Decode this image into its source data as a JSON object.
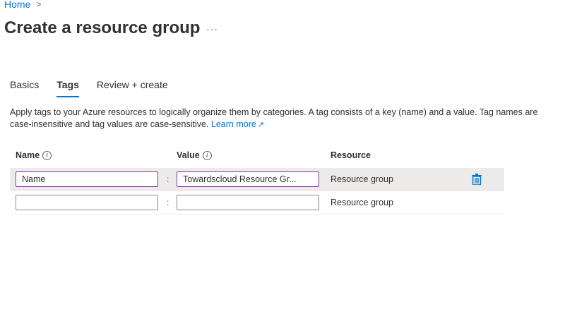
{
  "breadcrumb": {
    "home": "Home",
    "separator": ">"
  },
  "page": {
    "title": "Create a resource group",
    "more": "···"
  },
  "tabs": [
    {
      "label": "Basics",
      "active": false
    },
    {
      "label": "Tags",
      "active": true
    },
    {
      "label": "Review + create",
      "active": false
    }
  ],
  "description": {
    "text": "Apply tags to your Azure resources to logically organize them by categories. A tag consists of a key (name) and a value. Tag names are case-insensitive and tag values are case-sensitive.",
    "link": "Learn more"
  },
  "table": {
    "headers": {
      "name": "Name",
      "value": "Value",
      "resource": "Resource"
    },
    "separator": ":",
    "rows": [
      {
        "name": "Name",
        "value": "Towardscloud Resource Gr...",
        "resource": "Resource group"
      },
      {
        "name": "",
        "value": "",
        "resource": "Resource group"
      }
    ]
  },
  "colors": {
    "accent": "#0078d4",
    "focus": "#8a2fa5",
    "trash": "#0078d4"
  }
}
